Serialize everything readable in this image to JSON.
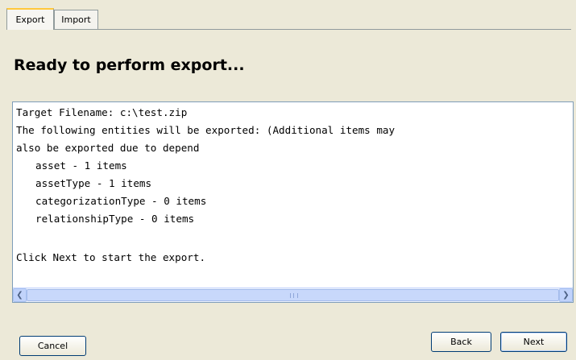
{
  "tabs": [
    {
      "label": "Export",
      "active": true
    },
    {
      "label": "Import",
      "active": false
    }
  ],
  "heading": "Ready to perform export...",
  "details": {
    "target_line": "Target Filename: c:\\test.zip",
    "entities_line_1": "The following entities will be exported: (Additional items may",
    "entities_line_2": "also be exported due to depend",
    "items": [
      "asset - 1 items",
      "assetType - 1 items",
      "categorizationType - 0 items",
      "relationshipType - 0 items"
    ],
    "instruction": "Click Next to start the export."
  },
  "buttons": {
    "cancel": "Cancel",
    "back": "Back",
    "next": "Next"
  },
  "scroll_icons": {
    "left": "chevron-left-icon",
    "right": "chevron-right-icon"
  }
}
